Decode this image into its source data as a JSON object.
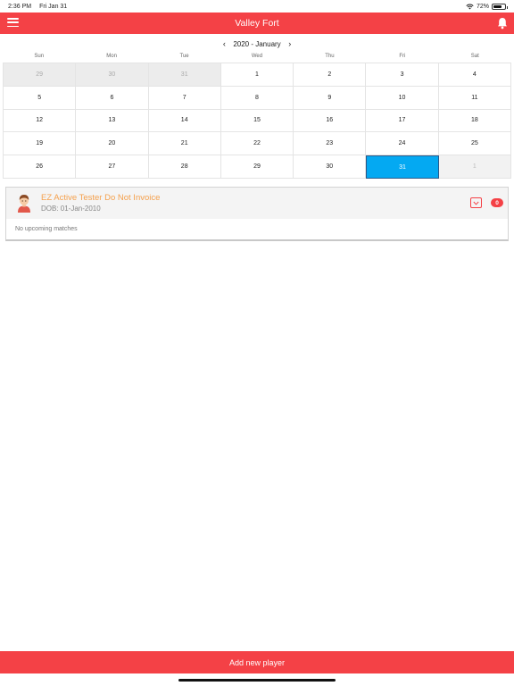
{
  "status_bar": {
    "time": "2:36 PM",
    "date": "Fri Jan 31",
    "battery": "72%",
    "battery_level": 0.72
  },
  "header": {
    "title": "Valley Fort",
    "menu_icon": "hamburger-menu-icon",
    "bell_icon": "bell-icon",
    "color": "#f44146"
  },
  "calendar": {
    "month_label": "2020 - January",
    "prev_icon": "chevron-left-icon",
    "next_icon": "chevron-right-icon",
    "weekdays": [
      "Sun",
      "Mon",
      "Tue",
      "Wed",
      "Thu",
      "Fri",
      "Sat"
    ],
    "weeks": [
      [
        "29",
        "30",
        "31",
        "1",
        "2",
        "3",
        "4"
      ],
      [
        "5",
        "6",
        "7",
        "8",
        "9",
        "10",
        "11"
      ],
      [
        "12",
        "13",
        "14",
        "15",
        "16",
        "17",
        "18"
      ],
      [
        "19",
        "20",
        "21",
        "22",
        "23",
        "24",
        "25"
      ],
      [
        "26",
        "27",
        "28",
        "29",
        "30",
        "31",
        "1"
      ]
    ],
    "selected_day": "31",
    "selected_color": "#04a9f2"
  },
  "player": {
    "name": "EZ Active Tester Do Not Invoice",
    "dob": "DOB: 01-Jan-2010",
    "match_count": "0",
    "no_matches_text": "No upcoming matches",
    "avatar_icon": "avatar-icon",
    "name_color": "#f5a04c"
  },
  "footer": {
    "add_player_label": "Add new player"
  }
}
